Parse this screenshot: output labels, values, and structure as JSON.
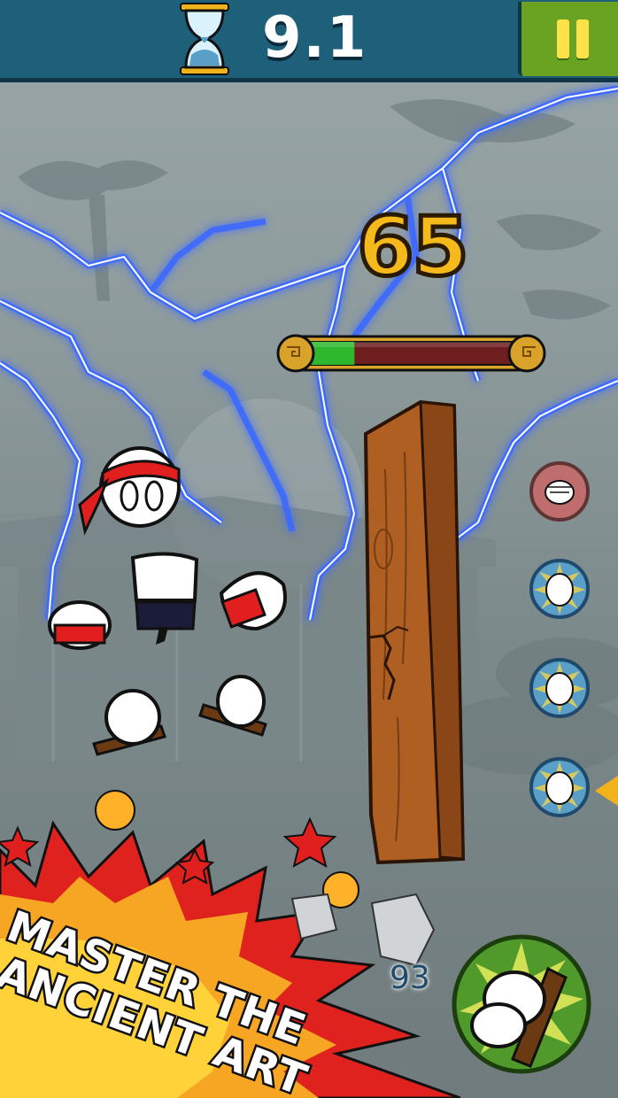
{
  "hud": {
    "timer": "9.1",
    "pause_icon": "pause-icon",
    "hourglass_icon": "hourglass-icon"
  },
  "game": {
    "score": "65",
    "power_meter_fill": 0.23,
    "hits_remaining": "93",
    "attacks": [
      {
        "name": "punch",
        "icon": "fist-icon"
      },
      {
        "name": "headbutt",
        "icon": "head-icon"
      },
      {
        "name": "headbutt",
        "icon": "head-icon"
      },
      {
        "name": "headbutt",
        "icon": "head-icon"
      }
    ],
    "selected_attack_index": 3,
    "action_icon": "foot-kick-icon"
  },
  "promo": {
    "line1": "MASTER THE",
    "line2": "ANCIENT ART"
  },
  "colors": {
    "topbar": "#1e5f7a",
    "pause_button": "#6aa321",
    "score": "#f6b91c",
    "meter_fill": "#2eb82e",
    "meter_empty": "#6e1e1e",
    "lightning": "#3d6bff"
  }
}
